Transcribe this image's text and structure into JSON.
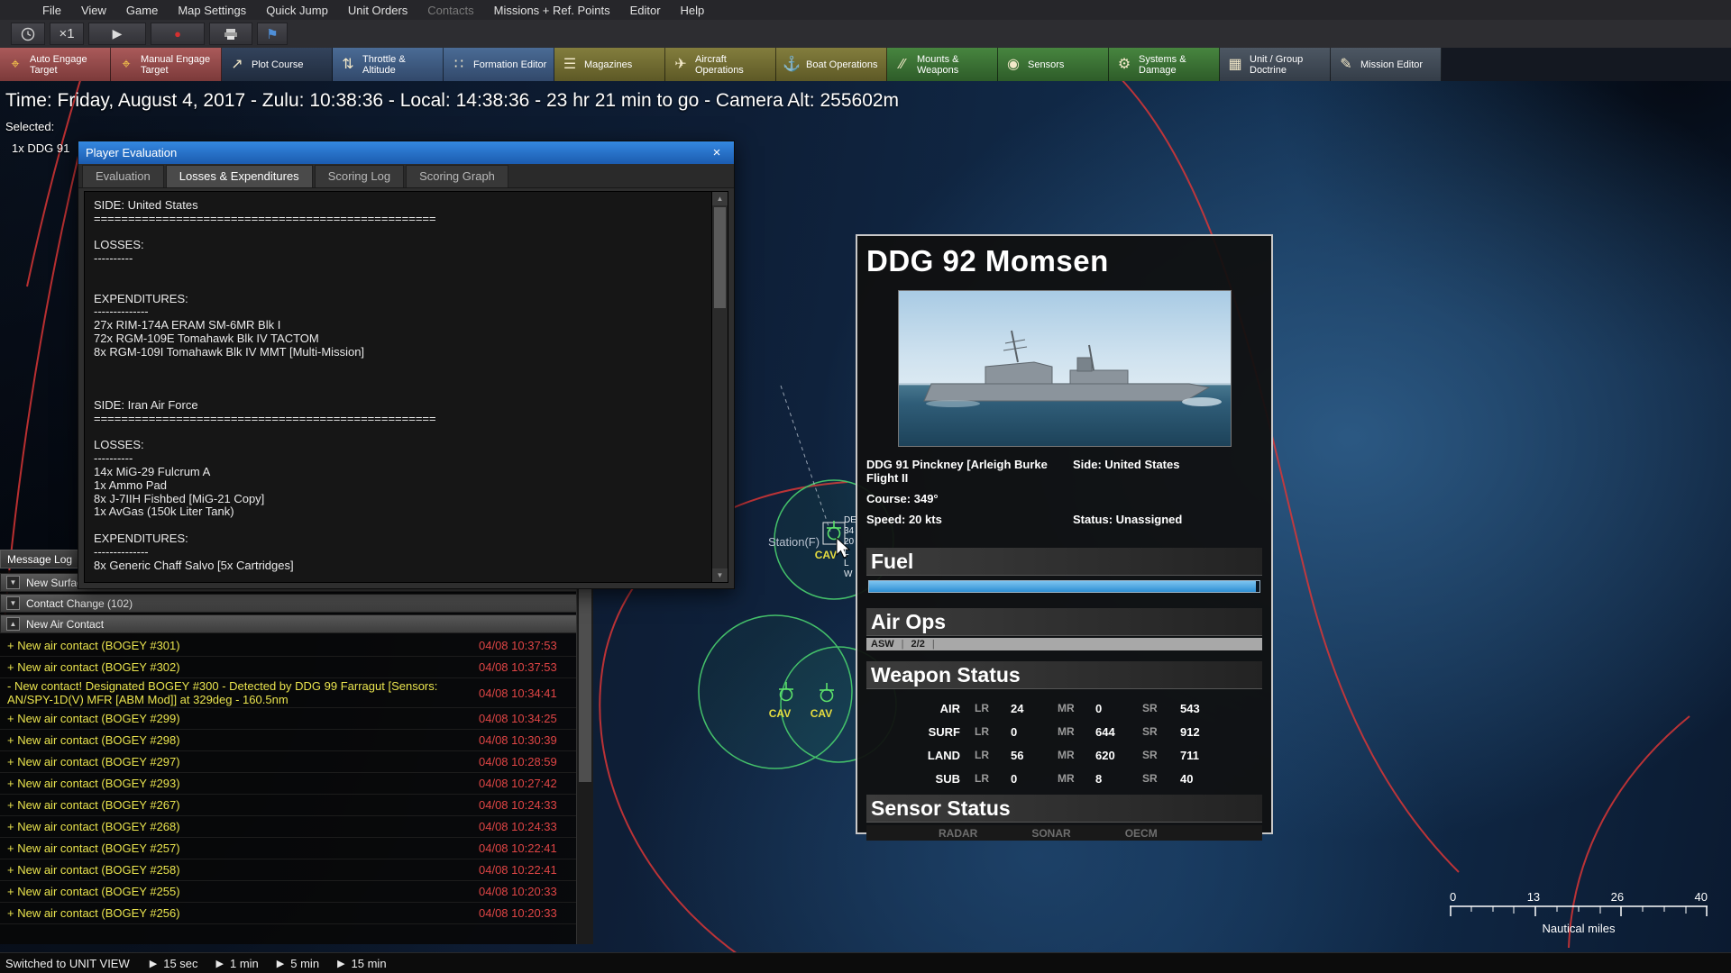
{
  "menubar": {
    "items": [
      "File",
      "View",
      "Game",
      "Map Settings",
      "Quick Jump",
      "Unit Orders",
      "Contacts",
      "Missions + Ref. Points",
      "Editor",
      "Help"
    ]
  },
  "quickbar": {
    "speed": "×1",
    "play_glyph": "▶",
    "record_glyph": "●",
    "flag_glyph": "⚑"
  },
  "toolbar": {
    "buttons": [
      {
        "label": "Auto Engage Target",
        "glyph": "⌖"
      },
      {
        "label": "Manual Engage Target",
        "glyph": "⌖"
      },
      {
        "label": "Plot Course",
        "glyph": "↗"
      },
      {
        "label": "Throttle & Altitude",
        "glyph": "⇅"
      },
      {
        "label": "Formation Editor",
        "glyph": "∷"
      },
      {
        "label": "Magazines",
        "glyph": "☰"
      },
      {
        "label": "Aircraft Operations",
        "glyph": "✈"
      },
      {
        "label": "Boat Operations",
        "glyph": "⚓"
      },
      {
        "label": "Mounts & Weapons",
        "glyph": "∕∕"
      },
      {
        "label": "Sensors",
        "glyph": "◉"
      },
      {
        "label": "Systems & Damage",
        "glyph": "⚙"
      },
      {
        "label": "Unit / Group Doctrine",
        "glyph": "▦"
      },
      {
        "label": "Mission Editor",
        "glyph": "✎"
      }
    ]
  },
  "hud": {
    "time_text": "Time: Friday, August 4, 2017 - Zulu: 10:38:36 - Local: 14:38:36 - 23 hr 21 min to go -  Camera Alt: 255602m",
    "selected_label": "Selected:",
    "selected_value": "1x DDG 91"
  },
  "player_evaluation": {
    "title": "Player Evaluation",
    "close_glyph": "×",
    "tabs": [
      "Evaluation",
      "Losses & Expenditures",
      "Scoring Log",
      "Scoring Graph"
    ],
    "content_lines": [
      "SIDE: United States",
      "==================================================",
      "",
      "LOSSES:",
      "----------",
      "",
      "",
      "EXPENDITURES:",
      "--------------",
      "27x RIM-174A ERAM SM-6MR Blk I",
      "72x RGM-109E Tomahawk Blk IV TACTOM",
      "8x RGM-109I Tomahawk Blk IV MMT [Multi-Mission]",
      "",
      "",
      "",
      "SIDE: Iran Air Force",
      "==================================================",
      "",
      "LOSSES:",
      "----------",
      "14x MiG-29 Fulcrum A",
      "1x Ammo Pad",
      "8x J-7IIH Fishbed [MiG-21 Copy]",
      "1x AvGas (150k Liter Tank)",
      "",
      "EXPENDITURES:",
      "--------------",
      "8x Generic Chaff Salvo [5x Cartridges]"
    ],
    "scroll_up_glyph": "▲",
    "scroll_down_glyph": "▼"
  },
  "message_log": {
    "tab_label": "Message Log",
    "sections": [
      {
        "label": "New Surfac",
        "glyph": "▼"
      },
      {
        "label": "Contact Change (102)",
        "glyph": "▼"
      },
      {
        "label": "New Air Contact",
        "glyph": "▲"
      }
    ],
    "rows": [
      {
        "text": "+ New air contact (BOGEY #301)",
        "time": "04/08 10:37:53"
      },
      {
        "text": "+ New air contact (BOGEY #302)",
        "time": "04/08 10:37:53"
      },
      {
        "text": "- New contact! Designated BOGEY #300 - Detected by DDG 99 Farragut [Sensors: AN/SPY-1D(V) MFR [ABM Mod]] at 329deg - 160.5nm",
        "time": "04/08 10:34:41"
      },
      {
        "text": "+ New air contact (BOGEY #299)",
        "time": "04/08 10:34:25"
      },
      {
        "text": "+ New air contact (BOGEY #298)",
        "time": "04/08 10:30:39"
      },
      {
        "text": "+ New air contact (BOGEY #297)",
        "time": "04/08 10:28:59"
      },
      {
        "text": "+ New air contact (BOGEY #293)",
        "time": "04/08 10:27:42"
      },
      {
        "text": "+ New air contact (BOGEY #267)",
        "time": "04/08 10:24:33"
      },
      {
        "text": "+ New air contact (BOGEY #268)",
        "time": "04/08 10:24:33"
      },
      {
        "text": "+ New air contact (BOGEY #257)",
        "time": "04/08 10:22:41"
      },
      {
        "text": "+ New air contact (BOGEY #258)",
        "time": "04/08 10:22:41"
      },
      {
        "text": "+ New air contact (BOGEY #255)",
        "time": "04/08 10:20:33"
      },
      {
        "text": "+ New air contact (BOGEY #256)",
        "time": "04/08 10:20:33"
      }
    ]
  },
  "unit_panel": {
    "title": "DDG 92 Momsen",
    "class_line": "DDG 91 Pinckney [Arleigh Burke Flight II",
    "side": "Side: United States",
    "course": "Course: 349°",
    "speed": "Speed: 20 kts",
    "status": "Status: Unassigned",
    "fuel": {
      "header": "Fuel",
      "percent": 99
    },
    "air_ops": {
      "header": "Air Ops",
      "ready_label": "ASW",
      "ready_value": "2/2",
      "divider": "|"
    },
    "weapon_status": {
      "header": "Weapon Status",
      "col_labels": {
        "lr": "LR",
        "mr": "MR",
        "sr": "SR"
      },
      "rows": [
        {
          "category": "AIR",
          "lr": "24",
          "mr": "0",
          "sr": "543"
        },
        {
          "category": "SURF",
          "lr": "0",
          "mr": "644",
          "sr": "912"
        },
        {
          "category": "LAND",
          "lr": "56",
          "mr": "620",
          "sr": "711"
        },
        {
          "category": "SUB",
          "lr": "0",
          "mr": "8",
          "sr": "40"
        }
      ]
    },
    "sensor_status": {
      "header": "Sensor Status",
      "items": [
        "RADAR",
        "SONAR",
        "OECM"
      ]
    }
  },
  "map": {
    "station_label": "Station(F)",
    "cav_labels": [
      "CAV",
      "CAV",
      "CAV"
    ],
    "datablock_lines": [
      "DE",
      "34",
      "20",
      "L",
      "L",
      "W"
    ],
    "ring_color": "#d93636",
    "contact_ring_color": "#44c06a"
  },
  "scalebar": {
    "ticks": [
      "0",
      "13",
      "26",
      "40"
    ],
    "unit_label": "Nautical miles"
  },
  "bottom_bar": {
    "status_text": "Switched to UNIT VIEW",
    "arrow_glyph": "▶",
    "presets": [
      "15 sec",
      "1 min",
      "5 min",
      "15 min"
    ]
  }
}
